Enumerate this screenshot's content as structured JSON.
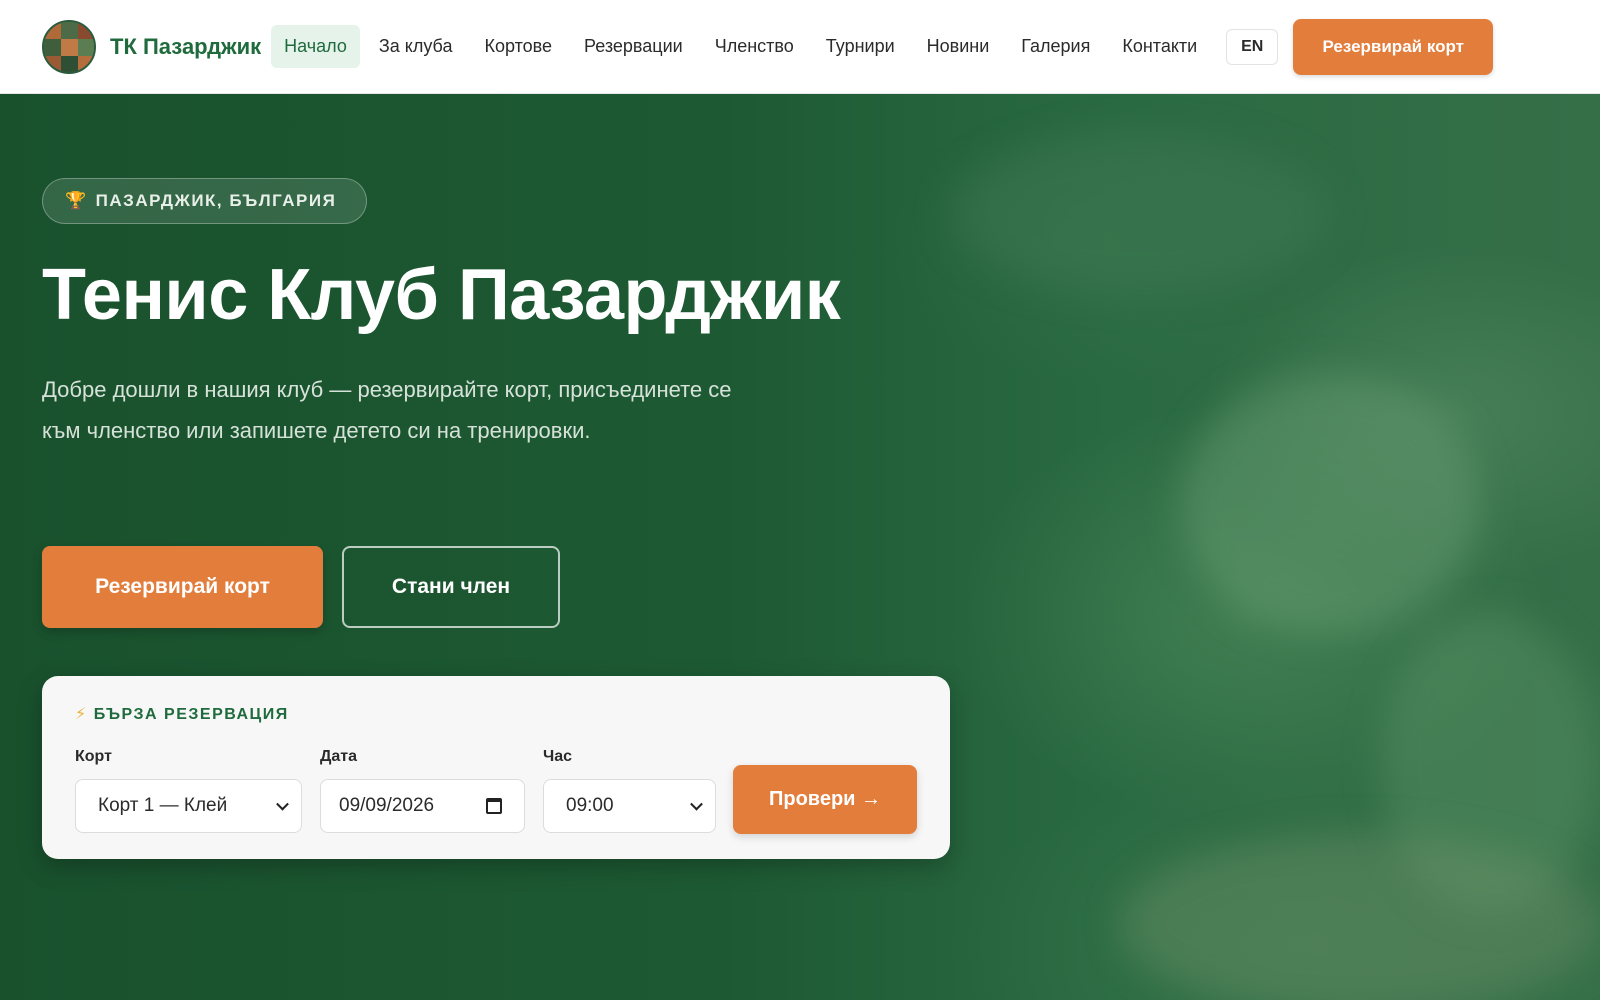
{
  "brand": {
    "name": "ТК Пазарджик"
  },
  "nav": {
    "items": [
      {
        "label": "Начало",
        "active": true
      },
      {
        "label": "За клуба",
        "active": false
      },
      {
        "label": "Кортове",
        "active": false
      },
      {
        "label": "Резервации",
        "active": false
      },
      {
        "label": "Членство",
        "active": false
      },
      {
        "label": "Турнири",
        "active": false
      },
      {
        "label": "Новини",
        "active": false
      },
      {
        "label": "Галерия",
        "active": false
      },
      {
        "label": "Контакти",
        "active": false
      }
    ],
    "lang": "EN",
    "cta": "Резервирай корт"
  },
  "hero": {
    "badge_icon": "🏆",
    "badge": "ПАЗАРДЖИК, БЪЛГАРИЯ",
    "title": "Тенис Клуб Пазарджик",
    "subtitle": "Добре дошли в нашия клуб — резервирайте корт, присъединете се към членство или запишете детето си на тренировки.",
    "primary_button": "Резервирай корт",
    "secondary_button": "Стани член"
  },
  "quick_booking": {
    "icon": "⚡",
    "title": "БЪРЗА РЕЗЕРВАЦИЯ",
    "court": {
      "label": "Корт",
      "value": "Корт 1 — Клей"
    },
    "date": {
      "label": "Дата",
      "value": "09/09/2026"
    },
    "time": {
      "label": "Час",
      "value": "09:00"
    },
    "submit": "Провери →"
  },
  "colors": {
    "brand_green": "#1f6b3d",
    "accent_orange": "#e27d3c",
    "hero_green": "#1d5a33"
  }
}
